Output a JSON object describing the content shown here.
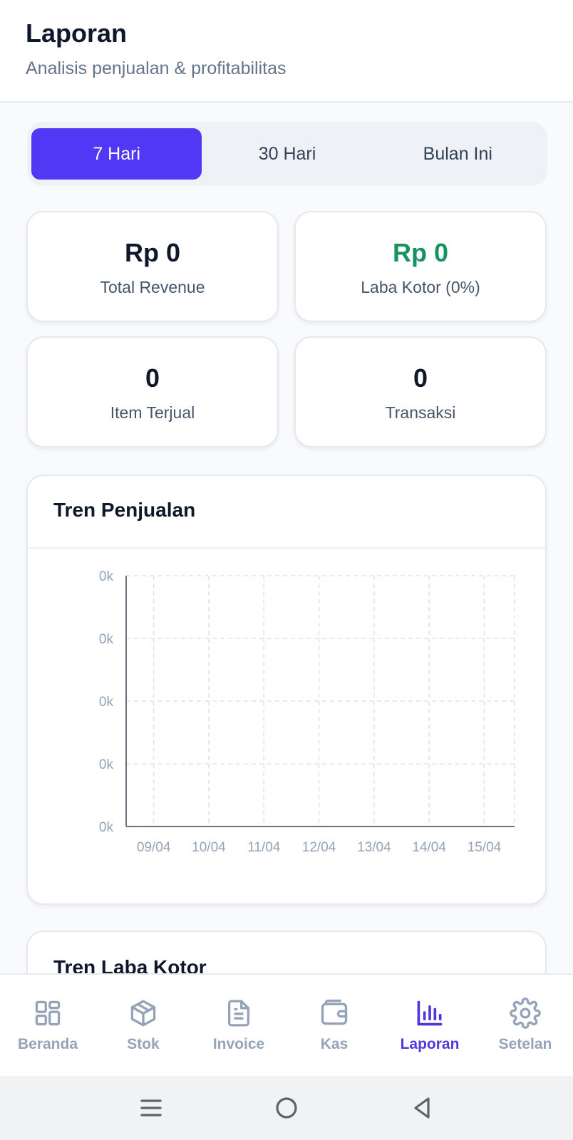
{
  "header": {
    "title": "Laporan",
    "subtitle": "Analisis penjualan & profitabilitas"
  },
  "period_tabs": [
    {
      "label": "7 Hari",
      "active": true
    },
    {
      "label": "30 Hari",
      "active": false
    },
    {
      "label": "Bulan Ini",
      "active": false
    }
  ],
  "stats": {
    "revenue": {
      "value": "Rp 0",
      "label": "Total Revenue"
    },
    "gross_profit": {
      "value": "Rp 0",
      "label": "Laba Kotor (0%)"
    },
    "items_sold": {
      "value": "0",
      "label": "Item Terjual"
    },
    "transactions": {
      "value": "0",
      "label": "Transaksi"
    }
  },
  "sales_chart": {
    "title": "Tren Penjualan"
  },
  "profit_chart": {
    "title": "Tren Laba Kotor"
  },
  "chart_data": {
    "type": "line",
    "title": "Tren Penjualan",
    "categories": [
      "09/04",
      "10/04",
      "11/04",
      "12/04",
      "13/04",
      "14/04",
      "15/04"
    ],
    "series": [
      {
        "values": [
          0,
          0,
          0,
          0,
          0,
          0,
          0
        ]
      }
    ],
    "y_tick_labels": [
      "0k",
      "0k",
      "0k",
      "0k",
      "0k"
    ],
    "xlabel": "",
    "ylabel": "",
    "grid": true
  },
  "nav": [
    {
      "label": "Beranda",
      "icon": "grid-icon",
      "active": false
    },
    {
      "label": "Stok",
      "icon": "box-icon",
      "active": false
    },
    {
      "label": "Invoice",
      "icon": "document-icon",
      "active": false
    },
    {
      "label": "Kas",
      "icon": "wallet-icon",
      "active": false
    },
    {
      "label": "Laporan",
      "icon": "bar-chart-icon",
      "active": true
    },
    {
      "label": "Setelan",
      "icon": "gear-icon",
      "active": false
    }
  ],
  "colors": {
    "accent": "#5038f5",
    "profit_green": "#16935f",
    "muted": "#94a3b8"
  }
}
